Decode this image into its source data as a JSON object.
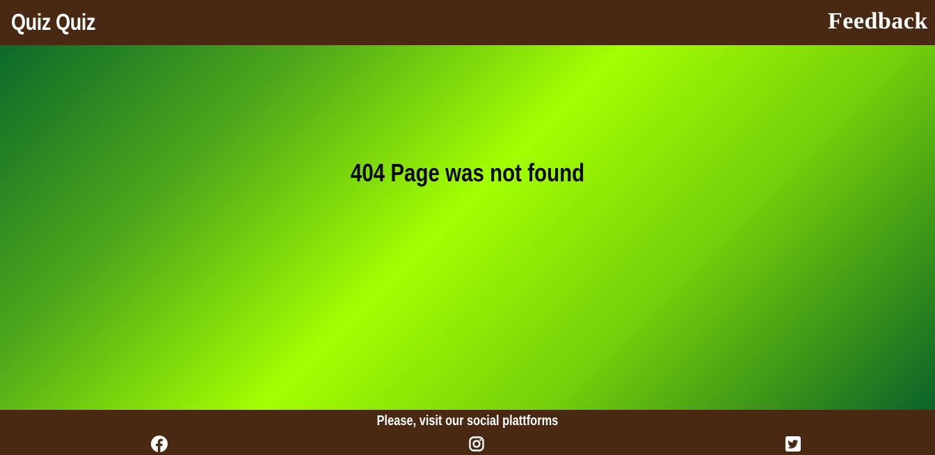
{
  "header": {
    "logo_text": "Quiz Quiz",
    "nav": {
      "feedback_label": "Feedback"
    },
    "background_color": "#4a2912"
  },
  "main": {
    "message": "404 Page was not found",
    "gradient_colors": [
      "#0b6a2a",
      "#a3ff00",
      "#0a632a"
    ]
  },
  "footer": {
    "text": "Please, visit our social plattforms",
    "social_links": [
      {
        "name": "facebook",
        "icon": "facebook-icon"
      },
      {
        "name": "instagram",
        "icon": "instagram-icon"
      },
      {
        "name": "twitter",
        "icon": "twitter-icon"
      }
    ],
    "background_color": "#4a2912"
  }
}
